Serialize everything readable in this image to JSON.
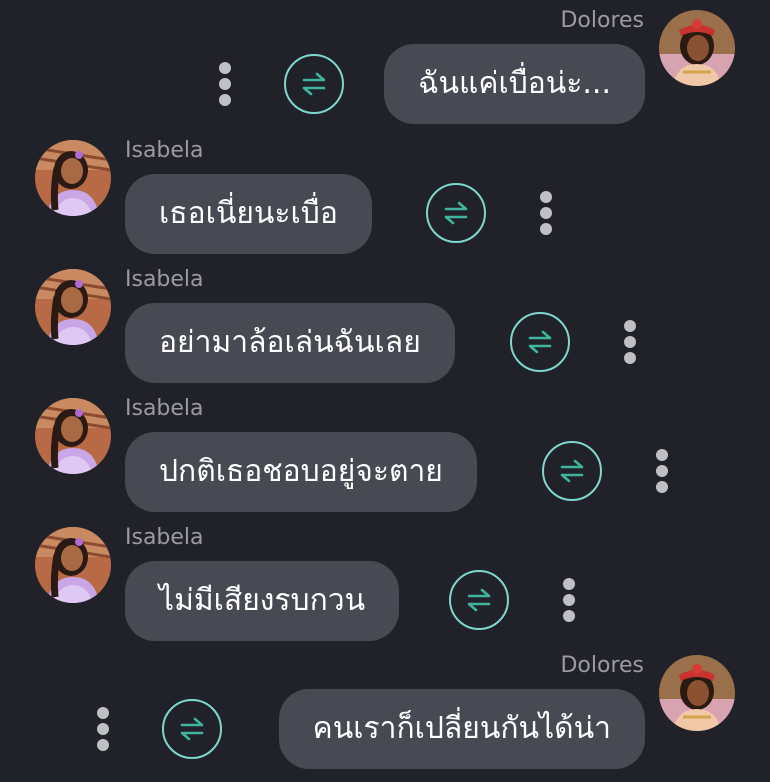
{
  "messages": [
    {
      "sender": "Dolores",
      "text": "ฉันแค่เบื่อน่ะ...",
      "side": "right",
      "avatar_icon": "dolores-avatar-icon",
      "swap_icon": "swap-arrows-icon",
      "menu_icon": "more-vertical-icon"
    },
    {
      "sender": "Isabela",
      "text": "เธอเนี่ยนะเบื่อ",
      "side": "left",
      "avatar_icon": "isabela-avatar-icon",
      "swap_icon": "swap-arrows-icon",
      "menu_icon": "more-vertical-icon"
    },
    {
      "sender": "Isabela",
      "text": "อย่ามาล้อเล่นฉันเลย",
      "side": "left",
      "avatar_icon": "isabela-avatar-icon",
      "swap_icon": "swap-arrows-icon",
      "menu_icon": "more-vertical-icon"
    },
    {
      "sender": "Isabela",
      "text": "ปกติเธอชอบอยู่จะตาย",
      "side": "left",
      "avatar_icon": "isabela-avatar-icon",
      "swap_icon": "swap-arrows-icon",
      "menu_icon": "more-vertical-icon"
    },
    {
      "sender": "Isabela",
      "text": "ไม่มีเสียงรบกวน",
      "side": "left",
      "avatar_icon": "isabela-avatar-icon",
      "swap_icon": "swap-arrows-icon",
      "menu_icon": "more-vertical-icon"
    },
    {
      "sender": "Dolores",
      "text": "คนเราก็เปลี่ยนกันได้น่า",
      "side": "right",
      "avatar_icon": "dolores-avatar-icon",
      "swap_icon": "swap-arrows-icon",
      "menu_icon": "more-vertical-icon"
    }
  ],
  "colors": {
    "background": "#212229",
    "bubble": "#474a52",
    "text": "#ffffff",
    "sender_name": "#9a9ba0",
    "accent": "#7fd6cf",
    "dots": "#bfc0c4"
  }
}
